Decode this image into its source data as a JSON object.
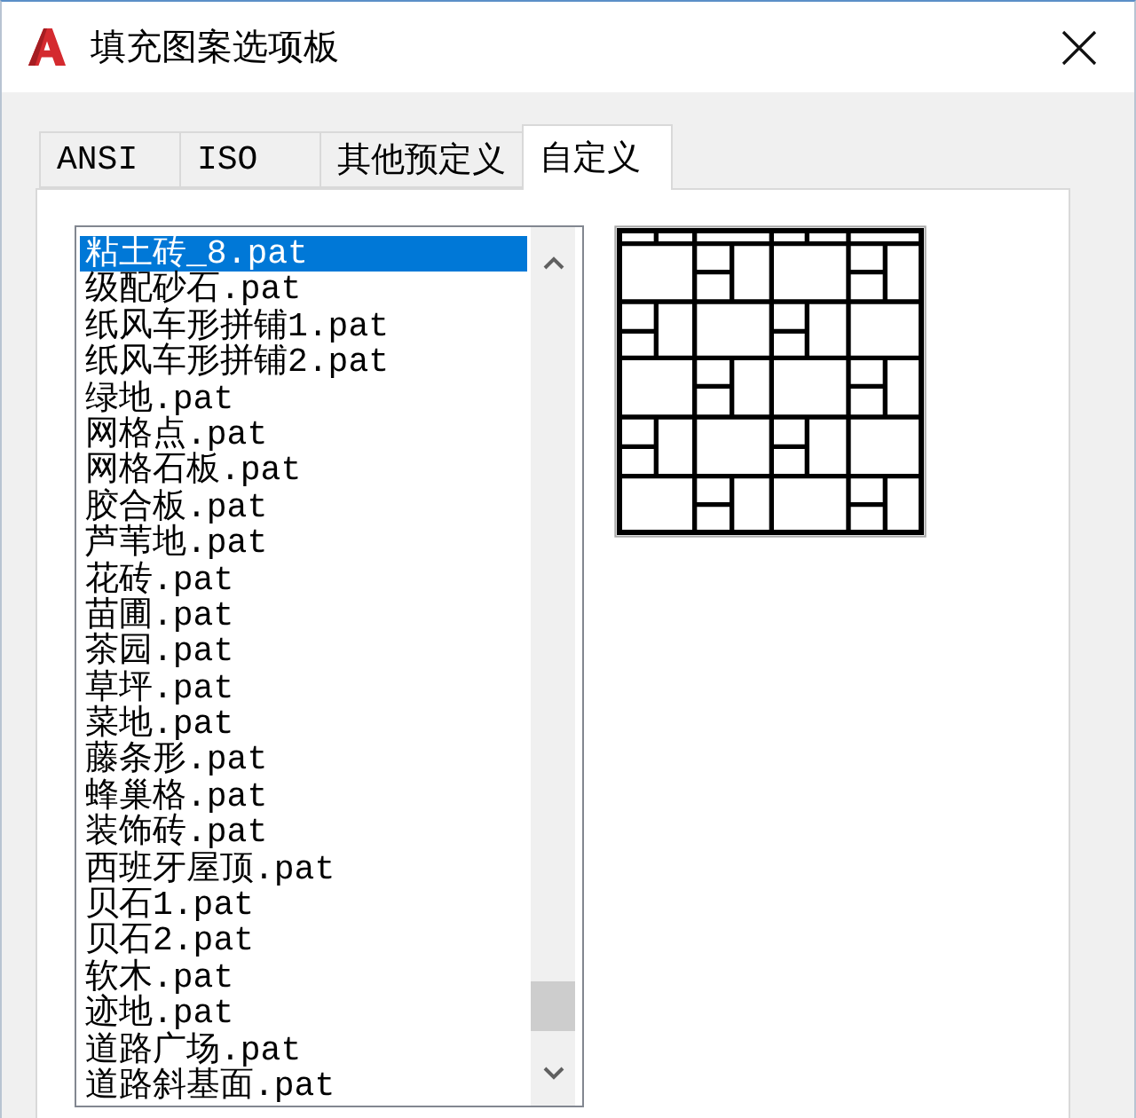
{
  "window": {
    "title": "填充图案选项板"
  },
  "tabs": [
    {
      "label": "ANSI",
      "selected": false
    },
    {
      "label": "ISO",
      "selected": false
    },
    {
      "label": "其他预定义",
      "selected": false
    },
    {
      "label": "自定义",
      "selected": true
    }
  ],
  "pattern_list": {
    "items": [
      {
        "label": "粘土砖_8.pat",
        "selected": true
      },
      {
        "label": "级配砂石.pat",
        "selected": false
      },
      {
        "label": "纸风车形拼铺1.pat",
        "selected": false
      },
      {
        "label": "纸风车形拼铺2.pat",
        "selected": false
      },
      {
        "label": "绿地.pat",
        "selected": false
      },
      {
        "label": "网格点.pat",
        "selected": false
      },
      {
        "label": "网格石板.pat",
        "selected": false
      },
      {
        "label": "胶合板.pat",
        "selected": false
      },
      {
        "label": "芦苇地.pat",
        "selected": false
      },
      {
        "label": "花砖.pat",
        "selected": false
      },
      {
        "label": "苗圃.pat",
        "selected": false
      },
      {
        "label": "茶园.pat",
        "selected": false
      },
      {
        "label": "草坪.pat",
        "selected": false
      },
      {
        "label": "菜地.pat",
        "selected": false
      },
      {
        "label": "藤条形.pat",
        "selected": false
      },
      {
        "label": "蜂巢格.pat",
        "selected": false
      },
      {
        "label": "装饰砖.pat",
        "selected": false
      },
      {
        "label": "西班牙屋顶.pat",
        "selected": false
      },
      {
        "label": "贝石1.pat",
        "selected": false
      },
      {
        "label": "贝石2.pat",
        "selected": false
      },
      {
        "label": "软木.pat",
        "selected": false
      },
      {
        "label": "迹地.pat",
        "selected": false
      },
      {
        "label": "道路广场.pat",
        "selected": false
      },
      {
        "label": "道路斜基面.pat",
        "selected": false
      }
    ]
  }
}
